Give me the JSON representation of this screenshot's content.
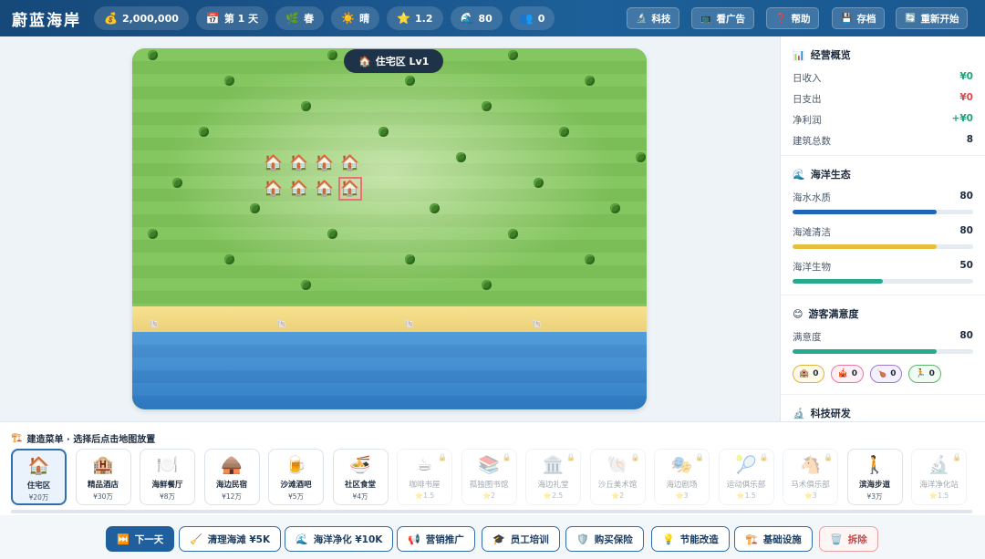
{
  "app": {
    "title": "蔚蓝海岸"
  },
  "topbar": {
    "stats": [
      {
        "icon": "💰",
        "icon_name": "money-bag-icon",
        "value": "2,000,000"
      },
      {
        "icon": "📅",
        "icon_name": "calendar-icon",
        "value": "第 1 天"
      },
      {
        "icon": "🌿",
        "icon_name": "herb-icon",
        "value": "春"
      },
      {
        "icon": "☀️",
        "icon_name": "sun-icon",
        "value": "晴"
      },
      {
        "icon": "⭐",
        "icon_name": "star-icon",
        "value": "1.2"
      },
      {
        "icon": "🌊",
        "icon_name": "wave-icon",
        "value": "80"
      },
      {
        "icon": "👥",
        "icon_name": "people-icon",
        "value": "0"
      }
    ],
    "buttons": [
      {
        "icon": "🔬",
        "icon_name": "microscope-icon",
        "label": "科技"
      },
      {
        "icon": "📺",
        "icon_name": "tv-icon",
        "label": "看广告"
      },
      {
        "icon": "❓",
        "icon_name": "question-icon",
        "label": "帮助"
      },
      {
        "icon": "💾",
        "icon_name": "save-icon",
        "label": "存档"
      },
      {
        "icon": "🔄",
        "icon_name": "restart-icon",
        "label": "重新开始"
      }
    ]
  },
  "map": {
    "zone_icon": "🏠",
    "zone_label": "住宅区 Lv1",
    "house_icon": "🏠",
    "shell_icon": "🐚"
  },
  "panel": {
    "overview": {
      "icon": "📊",
      "title": "经营概览",
      "rows": [
        {
          "label": "日收入",
          "value": "¥0",
          "color": "#22a37a"
        },
        {
          "label": "日支出",
          "value": "¥0",
          "color": "#e04848"
        },
        {
          "label": "净利润",
          "value": "+¥0",
          "color": "#22a37a"
        },
        {
          "label": "建筑总数",
          "value": "8",
          "color": "#1d2b3f"
        }
      ]
    },
    "ocean": {
      "icon": "🌊",
      "title": "海洋生态",
      "bars": [
        {
          "label": "海水水质",
          "value": "80",
          "level": 0.8,
          "color": "#2065b8"
        },
        {
          "label": "海滩清洁",
          "value": "80",
          "level": 0.8,
          "color": "#e6bf3c"
        },
        {
          "label": "海洋生物",
          "value": "50",
          "level": 0.5,
          "color": "#27a98e"
        }
      ]
    },
    "satisfaction": {
      "icon": "😊",
      "title": "游客满意度",
      "label": "满意度",
      "value": "80",
      "level": 0.8,
      "color": "#27a98e",
      "chips": [
        {
          "icon": "🏨",
          "icon_name": "hotel-icon",
          "value": "0",
          "color": "#e0b43a",
          "bg": "#fff9e8"
        },
        {
          "icon": "🎪",
          "icon_name": "circus-icon",
          "value": "0",
          "color": "#e57aa8",
          "bg": "#fff0f6"
        },
        {
          "icon": "🍗",
          "icon_name": "food-icon",
          "value": "0",
          "color": "#9a7bd1",
          "bg": "#f5f0ff"
        },
        {
          "icon": "🏃",
          "icon_name": "runner-icon",
          "value": "0",
          "color": "#5fb56f",
          "bg": "#f0fbf2"
        }
      ]
    },
    "tech": {
      "icon": "🔬",
      "title": "科技研发"
    }
  },
  "build_menu": {
    "icon": "🏗️",
    "title": "建造菜单 · 选择后点击地图放置",
    "items": [
      {
        "icon": "🏠",
        "name": "住宅区",
        "price": "¥20万",
        "locked": false,
        "selected": true
      },
      {
        "icon": "🏨",
        "name": "精品酒店",
        "price": "¥30万",
        "locked": false,
        "selected": false
      },
      {
        "icon": "🍽️",
        "name": "海鲜餐厅",
        "price": "¥8万",
        "locked": false,
        "selected": false
      },
      {
        "icon": "🛖",
        "name": "海边民宿",
        "price": "¥12万",
        "locked": false,
        "selected": false
      },
      {
        "icon": "🍺",
        "name": "沙滩酒吧",
        "price": "¥5万",
        "locked": false,
        "selected": false
      },
      {
        "icon": "🍜",
        "name": "社区食堂",
        "price": "¥4万",
        "locked": false,
        "selected": false
      },
      {
        "icon": "☕",
        "name": "咖啡书屋",
        "price": "⭐1.5",
        "locked": true,
        "selected": false
      },
      {
        "icon": "📚",
        "name": "孤独图书馆",
        "price": "⭐2",
        "locked": true,
        "selected": false
      },
      {
        "icon": "🏛️",
        "name": "海边礼堂",
        "price": "⭐2.5",
        "locked": true,
        "selected": false
      },
      {
        "icon": "🐚",
        "name": "沙丘美术馆",
        "price": "⭐2",
        "locked": true,
        "selected": false
      },
      {
        "icon": "🎭",
        "name": "海边剧场",
        "price": "⭐3",
        "locked": true,
        "selected": false
      },
      {
        "icon": "🎾",
        "name": "运动俱乐部",
        "price": "⭐1.5",
        "locked": true,
        "selected": false
      },
      {
        "icon": "🐴",
        "name": "马术俱乐部",
        "price": "⭐3",
        "locked": true,
        "selected": false
      },
      {
        "icon": "🚶",
        "name": "滨海步道",
        "price": "¥3万",
        "locked": false,
        "selected": false
      },
      {
        "icon": "🔬",
        "name": "海洋净化站",
        "price": "⭐1.5",
        "locked": true,
        "selected": false
      }
    ]
  },
  "actions": [
    {
      "icon": "⏭️",
      "icon_name": "next-icon",
      "label": "下一天",
      "style": "primary"
    },
    {
      "icon": "🧹",
      "icon_name": "broom-icon",
      "label": "清理海滩 ¥5K",
      "style": "normal"
    },
    {
      "icon": "🌊",
      "icon_name": "wave-icon",
      "label": "海洋净化 ¥10K",
      "style": "normal"
    },
    {
      "icon": "📢",
      "icon_name": "megaphone-icon",
      "label": "营销推广",
      "style": "normal"
    },
    {
      "icon": "🎓",
      "icon_name": "graduation-icon",
      "label": "员工培训",
      "style": "normal"
    },
    {
      "icon": "🛡️",
      "icon_name": "shield-icon",
      "label": "购买保险",
      "style": "normal"
    },
    {
      "icon": "💡",
      "icon_name": "bulb-icon",
      "label": "节能改造",
      "style": "normal"
    },
    {
      "icon": "🏗️",
      "icon_name": "construction-icon",
      "label": "基础设施",
      "style": "normal"
    },
    {
      "icon": "🗑️",
      "icon_name": "trash-icon",
      "label": "拆除",
      "style": "danger"
    }
  ]
}
